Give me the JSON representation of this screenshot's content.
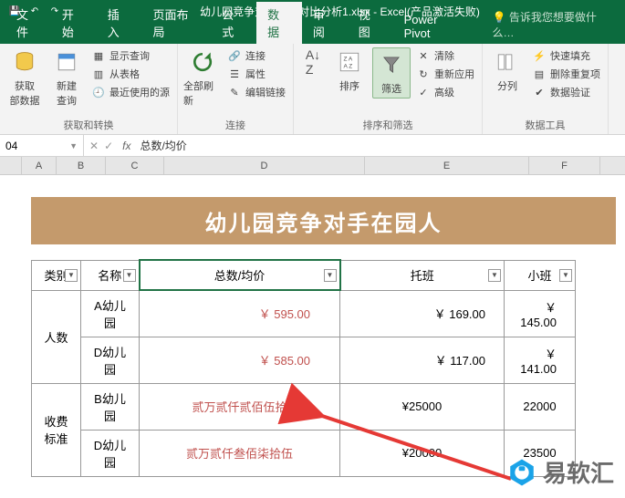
{
  "titlebar": {
    "filename": "幼儿园竞争对手数据对比分析1.xlsx - Excel(产品激活失败)"
  },
  "tabs": {
    "file": "文件",
    "home": "开始",
    "insert": "插入",
    "layout": "页面布局",
    "formulas": "公式",
    "data": "数据",
    "review": "审阅",
    "view": "视图",
    "powerpivot": "Power Pivot",
    "tellme": "告诉我您想要做什么…"
  },
  "ribbon": {
    "get_external": "获取\n部数据",
    "new_query": "新建\n查询",
    "show_queries": "显示查询",
    "from_table": "从表格",
    "recent": "最近使用的源",
    "group1_label": "获取和转换",
    "refresh_all": "全部刷新",
    "connections": "连接",
    "properties": "属性",
    "edit_links": "编辑链接",
    "group2_label": "连接",
    "sort": "排序",
    "filter": "筛选",
    "clear": "清除",
    "reapply": "重新应用",
    "advanced": "高级",
    "group3_label": "排序和筛选",
    "text_to_col": "分列",
    "flash_fill": "快速填充",
    "remove_dup": "删除重复项",
    "data_val": "数据验证",
    "group4_label": "数据工具"
  },
  "formula_bar": {
    "name_box": "04",
    "formula": "总数/均价"
  },
  "columns": {
    "A": "A",
    "B": "B",
    "C": "C",
    "D": "D",
    "E": "E",
    "F": "F"
  },
  "banner": "幼儿园竞争对手在园人",
  "table": {
    "h_category": "类别",
    "h_name": "名称",
    "h_total": "总数/均价",
    "h_tuoban": "托班",
    "h_xiaoban": "小班",
    "cat_count": "人数",
    "cat_fee": "收费标准",
    "rows": [
      {
        "name": "A幼儿园",
        "total": "￥ 595.00",
        "tuo": "￥ 169.00",
        "xiao": "￥ 145.00"
      },
      {
        "name": "D幼儿园",
        "total": "￥ 585.00",
        "tuo": "￥ 117.00",
        "xiao": "￥ 141.00"
      },
      {
        "name": "B幼儿园",
        "total": "贰万贰仟贰佰伍拾",
        "tuo": "¥25000",
        "xiao": "22000"
      },
      {
        "name": "D幼儿园",
        "total": "贰万贰仟叁佰柒拾伍",
        "tuo": "¥20000",
        "xiao": "23500"
      }
    ]
  },
  "watermark": "易软汇"
}
